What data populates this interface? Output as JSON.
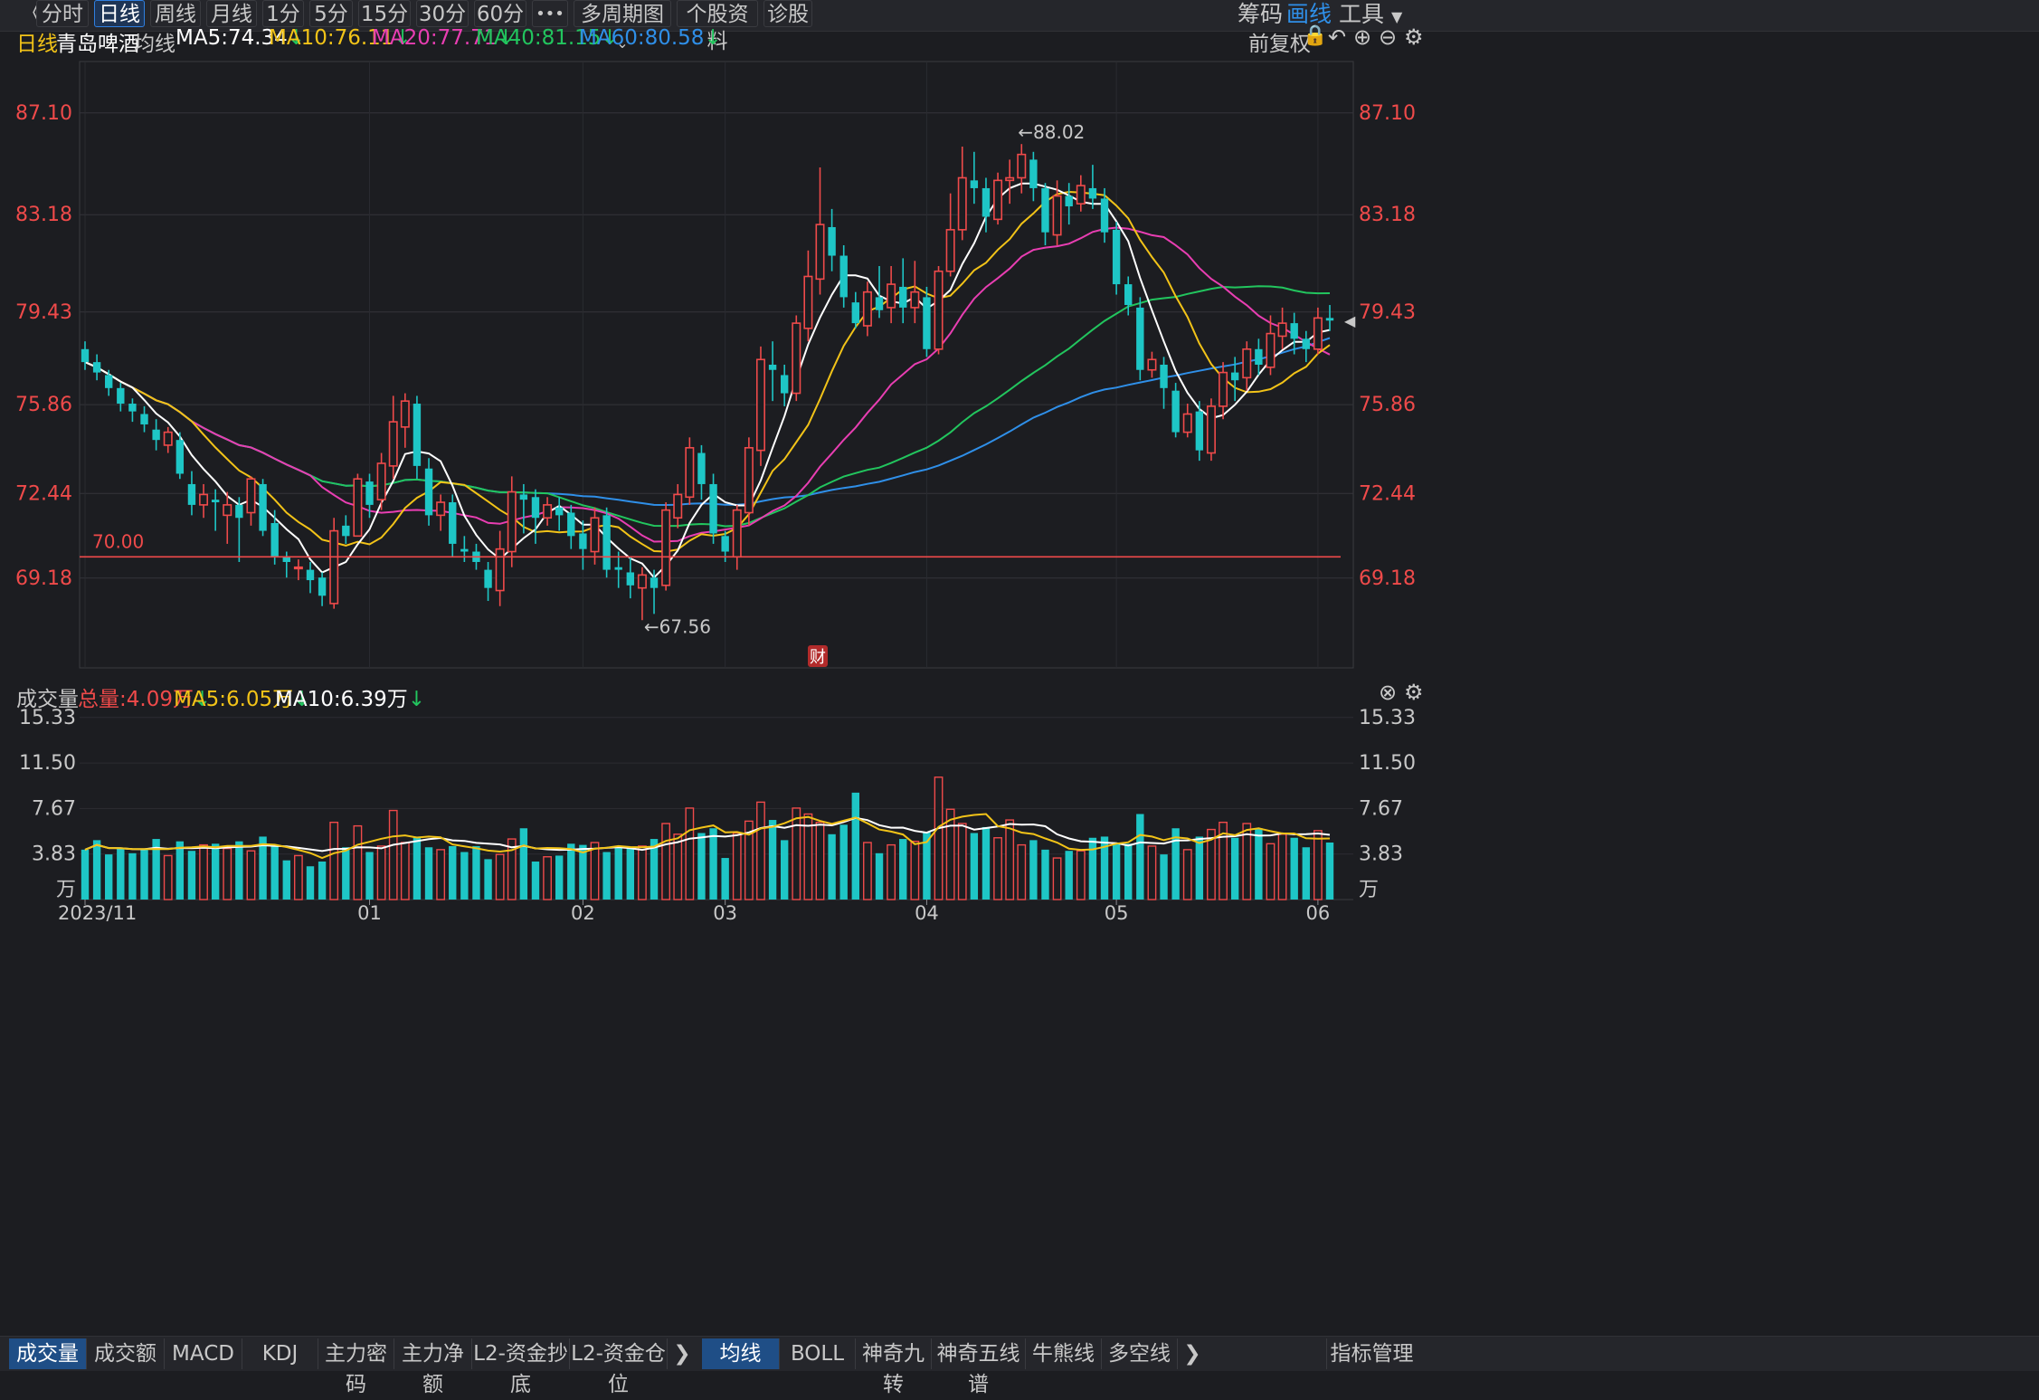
{
  "colors": {
    "up": "#ef4a4a",
    "down": "#1ec6c6",
    "ma5": "#ffffff",
    "ma10": "#f2c318",
    "ma20": "#e83eb2",
    "ma40": "#22c55e",
    "ma60": "#2f8fe8",
    "accent": "#2f7fe0"
  },
  "toolbar": {
    "back_icon": "double-chevron-left-icon",
    "periods": [
      "分时",
      "日线",
      "周线",
      "月线",
      "1分",
      "5分",
      "15分",
      "30分",
      "60分"
    ],
    "active_period": "日线",
    "more_label": "•••",
    "multi_period": "多周期图",
    "stock_info": "个股资料",
    "diagnose": "诊股",
    "chips": "筹码",
    "draw": "画线",
    "tools": "工具"
  },
  "header": {
    "chart_type": "日线",
    "stock_name": "青岛啤酒",
    "ma_label": "均线",
    "ma5": "MA5:74.34",
    "ma10": "MA10:76.11",
    "ma20": "MA20:77.71",
    "ma40": "MA40:81.15",
    "ma60": "MA60:80.58",
    "adjust": "前复权"
  },
  "volume_header": {
    "title": "成交量",
    "total": "总量:4.09万",
    "ma5": "MA5:6.05万",
    "ma10": "MA10:6.39万"
  },
  "chart_data": {
    "type": "candlestick",
    "price_ticks": [
      "87.10",
      "83.18",
      "79.43",
      "75.86",
      "72.44",
      "69.18"
    ],
    "price_tick_values": [
      87.1,
      83.18,
      79.43,
      75.86,
      72.44,
      69.18
    ],
    "ylim": [
      66.0,
      88.8
    ],
    "ref_line": {
      "label": "70.00",
      "value": 70.0
    },
    "high_annotation": "←88.02",
    "low_annotation": "←67.56",
    "fin_marker": "财",
    "x_labels": [
      "2023/11",
      "01",
      "02",
      "03",
      "04",
      "05",
      "06"
    ],
    "x_label_idx": [
      0,
      24,
      42,
      54,
      71,
      87,
      104
    ],
    "volume_ticks": [
      "15.33",
      "11.50",
      "7.67",
      "3.83",
      "万"
    ],
    "volume_tick_values": [
      15.33,
      11.5,
      7.67,
      3.83
    ],
    "volume_ylim": [
      0,
      16.0
    ],
    "candles": [
      [
        78.0,
        77.5,
        78.3,
        77.2,
        4.2
      ],
      [
        77.5,
        77.1,
        77.8,
        76.8,
        5.0
      ],
      [
        77.0,
        76.5,
        77.2,
        76.2,
        3.8
      ],
      [
        76.5,
        75.9,
        76.7,
        75.6,
        4.3
      ],
      [
        75.9,
        75.6,
        76.1,
        75.2,
        3.9
      ],
      [
        75.5,
        75.1,
        75.8,
        74.8,
        4.2
      ],
      [
        74.9,
        74.5,
        75.3,
        74.1,
        5.1
      ],
      [
        74.3,
        74.8,
        75.0,
        74.0,
        3.7
      ],
      [
        74.5,
        73.2,
        74.8,
        73.0,
        4.9
      ],
      [
        72.8,
        72.0,
        73.3,
        71.6,
        4.1
      ],
      [
        72.0,
        72.4,
        72.8,
        71.5,
        4.6
      ],
      [
        72.2,
        72.1,
        72.6,
        71.0,
        4.7
      ],
      [
        71.6,
        72.0,
        72.5,
        70.5,
        4.3
      ],
      [
        72.0,
        71.5,
        72.3,
        69.8,
        4.9
      ],
      [
        71.7,
        73.0,
        73.1,
        71.2,
        4.1
      ],
      [
        72.8,
        71.0,
        73.0,
        70.8,
        5.3
      ],
      [
        71.3,
        70.0,
        71.8,
        69.7,
        4.5
      ],
      [
        70.0,
        69.8,
        70.2,
        69.2,
        3.3
      ],
      [
        69.6,
        69.6,
        69.9,
        69.1,
        3.7
      ],
      [
        69.5,
        69.1,
        69.8,
        68.6,
        2.8
      ],
      [
        69.2,
        68.5,
        69.4,
        68.1,
        3.2
      ],
      [
        68.2,
        71.0,
        71.5,
        68.0,
        6.5
      ],
      [
        71.2,
        70.8,
        71.6,
        70.5,
        4.4
      ],
      [
        70.8,
        73.0,
        73.2,
        70.8,
        6.2
      ],
      [
        72.9,
        72.0,
        73.2,
        71.5,
        4.0
      ],
      [
        72.2,
        73.6,
        74.0,
        71.8,
        4.5
      ],
      [
        73.5,
        75.2,
        76.2,
        73.0,
        7.5
      ],
      [
        75.0,
        76.0,
        76.3,
        74.2,
        4.8
      ],
      [
        75.9,
        73.5,
        76.2,
        73.0,
        5.3
      ],
      [
        73.4,
        71.6,
        73.8,
        71.2,
        4.4
      ],
      [
        71.6,
        72.1,
        72.4,
        71.0,
        4.2
      ],
      [
        72.1,
        70.5,
        72.4,
        70.0,
        4.5
      ],
      [
        70.3,
        70.2,
        70.8,
        69.8,
        4.0
      ],
      [
        70.2,
        69.8,
        70.5,
        69.5,
        4.5
      ],
      [
        69.5,
        68.8,
        69.8,
        68.3,
        3.4
      ],
      [
        68.7,
        70.3,
        71.0,
        68.1,
        3.8
      ],
      [
        70.2,
        72.5,
        73.1,
        69.6,
        5.1
      ],
      [
        72.4,
        72.2,
        72.8,
        70.9,
        6.0
      ],
      [
        72.3,
        71.5,
        72.6,
        70.5,
        3.2
      ],
      [
        71.5,
        72.0,
        72.3,
        71.2,
        3.6
      ],
      [
        71.9,
        71.6,
        72.3,
        71.0,
        3.7
      ],
      [
        71.7,
        70.8,
        72.0,
        70.3,
        4.7
      ],
      [
        70.9,
        70.3,
        71.4,
        69.5,
        4.6
      ],
      [
        70.2,
        71.5,
        71.9,
        69.7,
        4.8
      ],
      [
        71.6,
        69.5,
        71.9,
        69.2,
        4.0
      ],
      [
        69.6,
        69.5,
        70.2,
        68.8,
        4.4
      ],
      [
        69.4,
        68.9,
        70.0,
        68.4,
        4.3
      ],
      [
        68.8,
        69.3,
        69.6,
        67.56,
        4.5
      ],
      [
        69.2,
        68.8,
        69.5,
        67.8,
        5.1
      ],
      [
        68.9,
        71.8,
        72.1,
        68.7,
        6.4
      ],
      [
        71.5,
        72.4,
        72.8,
        71.1,
        5.5
      ],
      [
        72.3,
        74.2,
        74.6,
        72.0,
        7.7
      ],
      [
        74.0,
        72.8,
        74.3,
        72.2,
        5.6
      ],
      [
        72.8,
        70.9,
        73.2,
        70.5,
        6.0
      ],
      [
        70.8,
        70.2,
        71.0,
        69.8,
        3.5
      ],
      [
        70.0,
        71.8,
        72.0,
        69.5,
        5.6
      ],
      [
        71.7,
        74.2,
        74.6,
        71.2,
        6.6
      ],
      [
        74.1,
        77.6,
        78.1,
        73.5,
        8.2
      ],
      [
        77.4,
        77.2,
        78.3,
        76.0,
        6.7
      ],
      [
        77.0,
        76.3,
        77.4,
        75.8,
        5.0
      ],
      [
        76.3,
        79.0,
        79.3,
        76.0,
        7.7
      ],
      [
        78.8,
        80.8,
        81.8,
        78.3,
        7.2
      ],
      [
        80.7,
        82.8,
        85.0,
        80.1,
        6.5
      ],
      [
        82.7,
        81.6,
        83.4,
        81.0,
        5.5
      ],
      [
        81.6,
        80.0,
        82.0,
        79.6,
        6.3
      ],
      [
        79.8,
        79.0,
        80.2,
        78.8,
        9.0
      ],
      [
        78.9,
        80.2,
        80.6,
        78.5,
        4.8
      ],
      [
        80.0,
        79.5,
        81.2,
        79.2,
        3.9
      ],
      [
        79.6,
        80.5,
        81.2,
        79.0,
        4.6
      ],
      [
        80.4,
        79.6,
        81.5,
        79.0,
        5.1
      ],
      [
        79.6,
        80.2,
        81.4,
        79.0,
        4.9
      ],
      [
        80.0,
        78.0,
        80.4,
        77.7,
        5.7
      ],
      [
        78.0,
        81.0,
        81.2,
        77.8,
        10.3
      ],
      [
        81.0,
        82.6,
        84.0,
        80.8,
        7.6
      ],
      [
        82.6,
        84.6,
        85.8,
        82.2,
        6.4
      ],
      [
        84.5,
        84.2,
        85.6,
        83.6,
        5.6
      ],
      [
        84.2,
        83.1,
        84.6,
        82.5,
        6.1
      ],
      [
        83.0,
        84.5,
        84.8,
        82.8,
        5.2
      ],
      [
        84.5,
        84.6,
        85.3,
        83.6,
        6.7
      ],
      [
        84.6,
        85.5,
        85.9,
        84.0,
        4.6
      ],
      [
        85.3,
        84.2,
        85.6,
        83.7,
        5.0
      ],
      [
        84.2,
        82.5,
        84.4,
        82.0,
        4.2
      ],
      [
        82.4,
        83.9,
        84.5,
        82.0,
        3.5
      ],
      [
        83.9,
        83.5,
        84.4,
        82.8,
        4.1
      ],
      [
        83.6,
        84.3,
        84.7,
        83.3,
        4.1
      ],
      [
        84.2,
        83.8,
        85.1,
        83.4,
        5.2
      ],
      [
        83.8,
        82.5,
        84.2,
        82.1,
        5.3
      ],
      [
        82.6,
        80.5,
        82.9,
        80.1,
        4.8
      ],
      [
        80.5,
        79.7,
        80.8,
        79.3,
        4.7
      ],
      [
        79.6,
        77.2,
        80.0,
        76.8,
        7.2
      ],
      [
        77.2,
        77.6,
        77.9,
        76.9,
        4.5
      ],
      [
        77.4,
        76.5,
        77.7,
        75.7,
        3.8
      ],
      [
        76.4,
        74.8,
        76.7,
        74.6,
        6.0
      ],
      [
        74.8,
        75.5,
        75.9,
        74.6,
        4.2
      ],
      [
        75.6,
        74.1,
        76.0,
        73.7,
        5.3
      ],
      [
        74.0,
        75.8,
        76.1,
        73.7,
        5.9
      ],
      [
        75.8,
        77.1,
        77.5,
        75.3,
        6.5
      ],
      [
        77.1,
        76.8,
        77.7,
        76.0,
        5.2
      ],
      [
        76.9,
        78.0,
        78.3,
        76.4,
        6.4
      ],
      [
        78.0,
        77.4,
        78.4,
        77.0,
        6.0
      ],
      [
        77.3,
        78.6,
        79.3,
        77.0,
        4.7
      ],
      [
        78.5,
        79.0,
        79.6,
        78.0,
        5.5
      ],
      [
        79.0,
        78.4,
        79.4,
        77.8,
        5.2
      ],
      [
        78.4,
        78.0,
        78.7,
        77.5,
        4.4
      ],
      [
        78.0,
        79.2,
        79.6,
        77.8,
        5.8
      ],
      [
        79.2,
        79.1,
        79.7,
        78.7,
        4.8
      ]
    ]
  },
  "bottom_tabs_left": [
    "成交量",
    "成交额",
    "MACD",
    "KDJ",
    "主力密码",
    "主力净额",
    "L2-资金抄底",
    "L2-资金仓位"
  ],
  "bottom_tabs_right": [
    "均线",
    "BOLL",
    "神奇九转",
    "神奇五线谱",
    "牛熊线",
    "多空线"
  ],
  "indicator_mgmt": "指标管理"
}
